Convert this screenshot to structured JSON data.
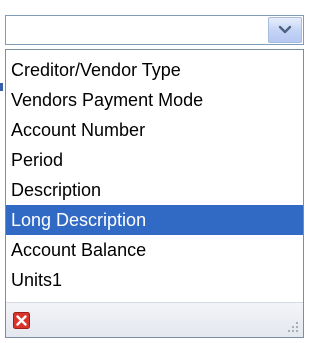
{
  "combo": {
    "value": "",
    "button_icon": "chevron-down-icon"
  },
  "dropdown": {
    "items": [
      "Creditor/Vendor Type",
      "Vendors Payment Mode",
      "Account Number",
      "Period",
      "Description",
      "Long Description",
      "Account Balance",
      "Units1"
    ],
    "selected": "Long Description",
    "footer": {
      "clear_icon": "red-x-icon",
      "grip_icon": "resize-grip-icon"
    }
  },
  "colors": {
    "selection": "#316ac5",
    "border": "#7f9db9",
    "clear_red": "#d9342b"
  }
}
